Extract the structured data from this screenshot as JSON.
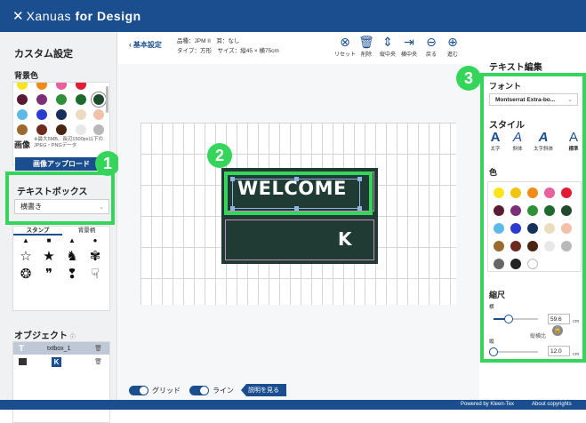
{
  "app": {
    "logo_mark": "✕",
    "logo_name": "Xanuas",
    "logo_suffix": "for Design"
  },
  "left": {
    "title": "カスタム設定",
    "bg_color_label": "背景色",
    "image_label": "画像",
    "image_note": "※最大5MB、長辺1500px以下の JPEG・PNGデータ",
    "upload_button": "画像アップロード",
    "textbox_label": "テキストボックス",
    "textbox_select": "横書き",
    "stamp_tabs": [
      "スタンプ",
      "背景柄"
    ],
    "object_label": "オブジェクト",
    "objects": [
      {
        "name": "txtbox_1",
        "type_icon": "T"
      },
      {
        "name": "",
        "type_icon": "K"
      }
    ]
  },
  "header": {
    "back_label": "基本設定",
    "meta_line1": "品種：JPM II　耳：なし",
    "meta_line2": "タイプ：方形　サイズ：縦45 × 横75cm",
    "tools": [
      {
        "icon": "reset-icon",
        "glyph": "⊗",
        "label": "リセット"
      },
      {
        "icon": "trash-icon",
        "glyph": "🗑",
        "label": "削除"
      },
      {
        "icon": "vertical-center-icon",
        "glyph": "⇕",
        "label": "縦中央"
      },
      {
        "icon": "horizontal-center-icon",
        "glyph": "⇥",
        "label": "横中央"
      },
      {
        "icon": "undo-icon",
        "glyph": "⊖",
        "label": "戻る"
      },
      {
        "icon": "redo-icon",
        "glyph": "⊕",
        "label": "進む"
      }
    ]
  },
  "canvas": {
    "mat_text": "WELCOME",
    "mat_logo": "K"
  },
  "bottom": {
    "grid_label": "グリッド",
    "line_label": "ライン",
    "help_button": "説明を見る",
    "zoom_out": "−",
    "zoom_in": "+"
  },
  "right": {
    "panel_title": "テキスト編集",
    "font_label": "フォント",
    "font_value": "Montserrat Extra-bo...",
    "style_label": "スタイル",
    "styles": [
      {
        "glyph": "A",
        "label": "太字"
      },
      {
        "glyph": "A",
        "label": "斜体"
      },
      {
        "glyph": "A",
        "label": "太字斜体"
      },
      {
        "glyph": "A",
        "label": "標準"
      }
    ],
    "color_label": "色",
    "colors": [
      "#f7e51a",
      "#f2c40f",
      "#f08a18",
      "#e8609c",
      "#e01d35",
      "#5a1a35",
      "#7a2f76",
      "#2f9038",
      "#1d6a2e",
      "#214a2c",
      "#5fb9e8",
      "#2a3bd0",
      "#16305a",
      "#ecdcbf",
      "#f2c1a8",
      "#9a6a2e",
      "#6e2a1e",
      "#4a2412",
      "#e8e8e8",
      "#b8b8b8",
      "#666666",
      "#222222",
      "#ffffff"
    ],
    "scale_label": "縮尺",
    "width_label": "横",
    "width_value": "59.6",
    "width_fraction": 0.33,
    "ratio_label": "縦横比",
    "height_label": "縦",
    "height_value": "12.0",
    "height_fraction": 0.0,
    "unit": "cm"
  },
  "callouts": {
    "one": "1",
    "two": "2",
    "three": "3"
  },
  "footer": {
    "powered": "Powered by Kleen-Tex",
    "about": "About copyrights"
  }
}
